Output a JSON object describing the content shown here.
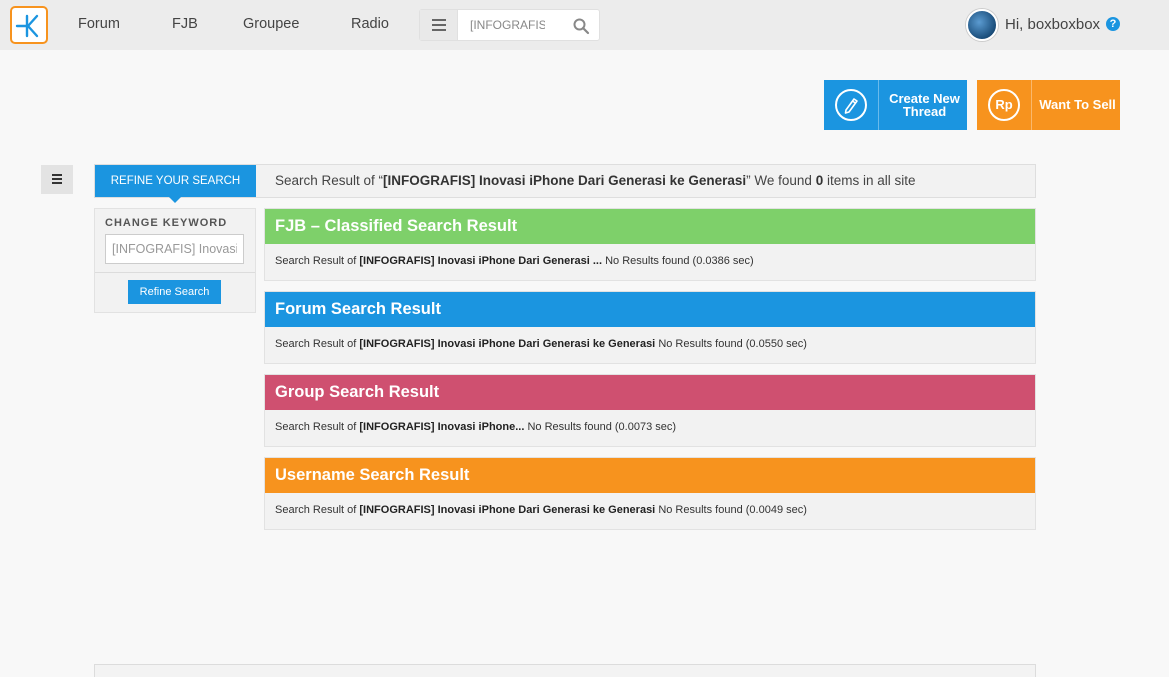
{
  "header": {
    "nav": [
      "Forum",
      "FJB",
      "Groupee",
      "Radio"
    ],
    "search_value": "[INFOGRAFIS",
    "greeting": "Hi, boxboxbox",
    "help": "?"
  },
  "actions": {
    "create_label": "Create New Thread",
    "create_line1": "Create New",
    "create_line2": "Thread",
    "sell_label": "Want To Sell",
    "sell_icon_text": "Rp"
  },
  "refine": {
    "tab_label": "REFINE YOUR SEARCH",
    "summary_prefix": "Search Result of “",
    "summary_query": "[INFOGRAFIS] Inovasi iPhone Dari Generasi ke Generasi",
    "summary_mid": "” We found ",
    "summary_count": "0",
    "summary_suffix": " items in all site"
  },
  "sidebar": {
    "change_keyword_label": "CHANGE KEYWORD",
    "keyword_value": "[INFOGRAFIS] Inovasi iPhone Dari Generasi ke Generasi",
    "refine_button": "Refine Search"
  },
  "results": [
    {
      "title": "FJB – Classified Search Result",
      "color": "#7ed06a",
      "prefix": "Search Result of ",
      "query": "[INFOGRAFIS] Inovasi iPhone Dari Generasi ...",
      "status": " No Results found (0.0386 sec)"
    },
    {
      "title": "Forum Search Result",
      "color": "#1b95e0",
      "prefix": "Search Result of ",
      "query": "[INFOGRAFIS] Inovasi iPhone Dari Generasi ke Generasi",
      "status": "No Results found (0.0550 sec)"
    },
    {
      "title": "Group Search Result",
      "color": "#cf5070",
      "prefix": "Search Result of ",
      "query": "[INFOGRAFIS] Inovasi iPhone...",
      "status": "No Results found (0.0073 sec)"
    },
    {
      "title": "Username Search Result",
      "color": "#f7931e",
      "prefix": "Search Result of ",
      "query": "[INFOGRAFIS] Inovasi iPhone Dari Generasi ke Generasi",
      "status": "No Results found (0.0049 sec)"
    }
  ],
  "colors": {
    "brand_blue": "#1b95e0",
    "brand_orange": "#f7931e"
  },
  "icons": [
    "kaskus-logo-icon",
    "hamburger-menu-icon",
    "search-icon",
    "avatar",
    "help-icon",
    "pencil-icon",
    "rupiah-icon",
    "sidebar-menu-icon"
  ]
}
